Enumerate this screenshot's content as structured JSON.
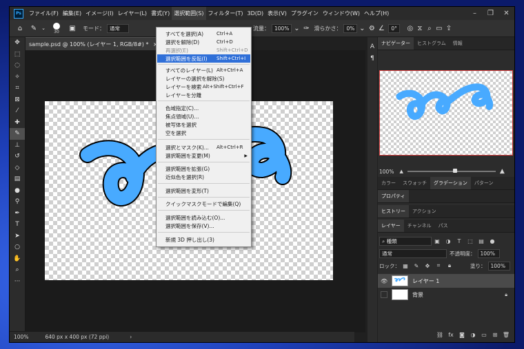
{
  "menubar": {
    "items": [
      "ファイル(F)",
      "編集(E)",
      "イメージ(I)",
      "レイヤー(L)",
      "書式(Y)",
      "選択範囲(S)",
      "フィルター(T)",
      "3D(D)",
      "表示(V)",
      "プラグイン",
      "ウィンドウ(W)",
      "ヘルプ(H)"
    ],
    "active_index": 5
  },
  "options": {
    "brush_size": "30",
    "mode_label": "モード：",
    "mode_value": "通常",
    "flow_label": "流量：",
    "flow_value": "100%",
    "smooth_label": "滑らかさ：",
    "smooth_value": "0%",
    "angle_value": "0°"
  },
  "document": {
    "tab_title": "sample.psd @ 100% (レイヤー 1, RGB/8#) *",
    "zoom": "100%",
    "info": "640 px x 400 px (72 ppi)"
  },
  "select_menu": {
    "items": [
      {
        "label": "すべてを選択(A)",
        "shortcut": "Ctrl+A"
      },
      {
        "label": "選択を解除(D)",
        "shortcut": "Ctrl+D"
      },
      {
        "label": "再選択(E)",
        "shortcut": "Shift+Ctrl+D",
        "disabled": true
      },
      {
        "label": "選択範囲を反転(I)",
        "shortcut": "Shift+Ctrl+I",
        "highlighted": true
      },
      {
        "label": "すべてのレイヤー(L)",
        "shortcut": "Alt+Ctrl+A"
      },
      {
        "label": "レイヤーの選択を解除(S)",
        "shortcut": ""
      },
      {
        "label": "レイヤーを検索",
        "shortcut": "Alt+Shift+Ctrl+F"
      },
      {
        "label": "レイヤーを分離",
        "shortcut": ""
      },
      {
        "label": "色域指定(C)...",
        "shortcut": ""
      },
      {
        "label": "焦点領域(U)...",
        "shortcut": ""
      },
      {
        "label": "被写体を選択",
        "shortcut": ""
      },
      {
        "label": "空を選択",
        "shortcut": ""
      },
      {
        "label": "選択とマスク(K)...",
        "shortcut": "Alt+Ctrl+R"
      },
      {
        "label": "選択範囲を変更(M)",
        "shortcut": "",
        "submenu": true
      },
      {
        "label": "選択範囲を拡張(G)",
        "shortcut": ""
      },
      {
        "label": "近似色を選択(R)",
        "shortcut": ""
      },
      {
        "label": "選択範囲を変形(T)",
        "shortcut": ""
      },
      {
        "label": "クイックマスクモードで編集(Q)",
        "shortcut": ""
      },
      {
        "label": "選択範囲を読み込む(O)...",
        "shortcut": ""
      },
      {
        "label": "選択範囲を保存(V)...",
        "shortcut": ""
      },
      {
        "label": "新規 3D 押し出し(3)",
        "shortcut": ""
      }
    ]
  },
  "panels": {
    "navigator_tabs": [
      "ナビゲーター",
      "ヒストグラム",
      "情報"
    ],
    "nav_zoom": "100%",
    "color_tabs": [
      "カラー",
      "スウォッチ",
      "グラデーション",
      "パターン"
    ],
    "properties_tab": "プロパティ",
    "history_tabs": [
      "ヒストリー",
      "アクション"
    ],
    "layer_tabs": [
      "レイヤー",
      "チャンネル",
      "パス"
    ],
    "kind_filter": "種類",
    "blend_mode": "通常",
    "opacity_label": "不透明度：",
    "opacity_value": "100%",
    "lock_label": "ロック：",
    "fill_label": "塗り：",
    "fill_value": "100%",
    "layers": [
      {
        "name": "レイヤー 1",
        "visible": true,
        "selected": true
      },
      {
        "name": "背景",
        "visible": false,
        "selected": false
      }
    ]
  },
  "colors": {
    "foreground": "#f29a00",
    "background": "#48aaff",
    "stroke": "#48aaff",
    "menu_highlight": "#2f6fd8"
  }
}
